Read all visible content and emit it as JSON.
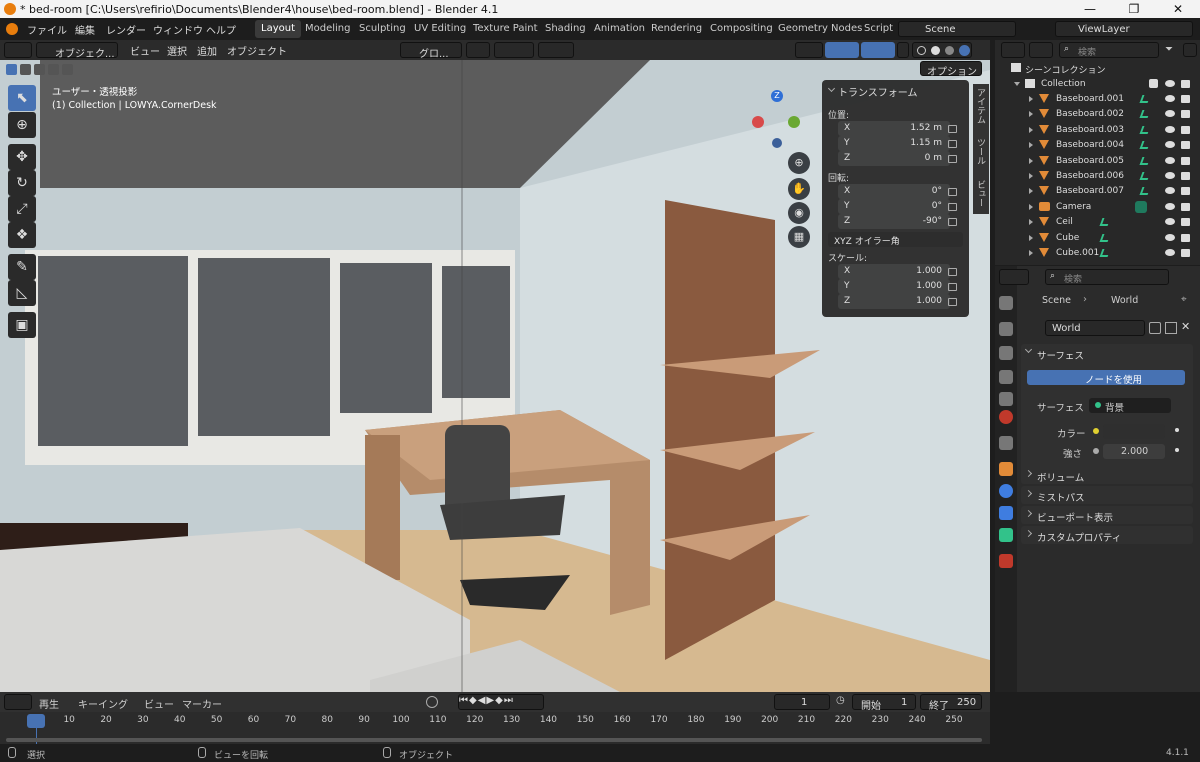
{
  "window": {
    "title": "* bed-room [C:\\Users\\refirio\\Documents\\Blender4\\house\\bed-room.blend] - Blender 4.1",
    "minimize": "—",
    "maximize": "❐",
    "close": "✕"
  },
  "menu": [
    "ファイル",
    "編集",
    "レンダー",
    "ウィンドウ",
    "ヘルプ"
  ],
  "workspaces": [
    "Layout",
    "Modeling",
    "Sculpting",
    "UV Editing",
    "Texture Paint",
    "Shading",
    "Animation",
    "Rendering",
    "Compositing",
    "Geometry Nodes",
    "Script"
  ],
  "scene": "Scene",
  "view_layer": "ViewLayer",
  "viewport": {
    "mode": "オブジェク...",
    "menus": [
      "ビュー",
      "選択",
      "追加",
      "オブジェクト"
    ],
    "orientation": "グロ...",
    "options": "オプション",
    "overlay_line1": "ユーザー・透視投影",
    "overlay_line2": "(1) Collection | LOWYA.CornerDesk"
  },
  "transform": {
    "header": "トランスフォーム",
    "location_label": "位置:",
    "location": [
      {
        "axis": "X",
        "value": "1.52 m"
      },
      {
        "axis": "Y",
        "value": "1.15 m"
      },
      {
        "axis": "Z",
        "value": "0 m"
      }
    ],
    "rotation_label": "回転:",
    "rotation": [
      {
        "axis": "X",
        "value": "0°"
      },
      {
        "axis": "Y",
        "value": "0°"
      },
      {
        "axis": "Z",
        "value": "-90°"
      }
    ],
    "rotation_mode": "XYZ オイラー角",
    "scale_label": "スケール:",
    "scale": [
      {
        "axis": "X",
        "value": "1.000"
      },
      {
        "axis": "Y",
        "value": "1.000"
      },
      {
        "axis": "Z",
        "value": "1.000"
      }
    ]
  },
  "side_tabs": [
    "アイテム",
    "ツール",
    "ビュー"
  ],
  "outliner": {
    "search_placeholder": "検索",
    "scene_collection": "シーンコレクション",
    "collection": "Collection",
    "items": [
      "Baseboard.001",
      "Baseboard.002",
      "Baseboard.003",
      "Baseboard.004",
      "Baseboard.005",
      "Baseboard.006",
      "Baseboard.007",
      "Camera",
      "Ceil",
      "Cube",
      "Cube.001"
    ]
  },
  "properties": {
    "search_placeholder": "検索",
    "breadcrumb_scene": "Scene",
    "breadcrumb_world": "World",
    "world_name": "World",
    "surface_header": "サーフェス",
    "use_nodes": "ノードを使用",
    "surface_label": "サーフェス",
    "surface_value": "背景",
    "color_label": "カラー",
    "strength_label": "強さ",
    "strength_value": "2.000",
    "panels": [
      "ボリューム",
      "ミストパス",
      "ビューポート表示",
      "カスタムプロパティ"
    ]
  },
  "timeline": {
    "menus": [
      "再生",
      "キーイング",
      "ビュー",
      "マーカー"
    ],
    "current_frame": "1",
    "start_label": "開始",
    "start_value": "1",
    "end_label": "終了",
    "end_value": "250",
    "ruler": [
      "1",
      "10",
      "20",
      "30",
      "40",
      "50",
      "60",
      "70",
      "80",
      "90",
      "100",
      "110",
      "120",
      "130",
      "140",
      "150",
      "160",
      "170",
      "180",
      "190",
      "200",
      "210",
      "220",
      "230",
      "240",
      "250"
    ]
  },
  "status": {
    "select": "選択",
    "rotate": "ビューを回転",
    "object": "オブジェクト",
    "version": "4.1.1"
  },
  "colors": {
    "accent": "#4772b3",
    "orange": "#e87d0d",
    "vertex_green": "#32c28a"
  }
}
